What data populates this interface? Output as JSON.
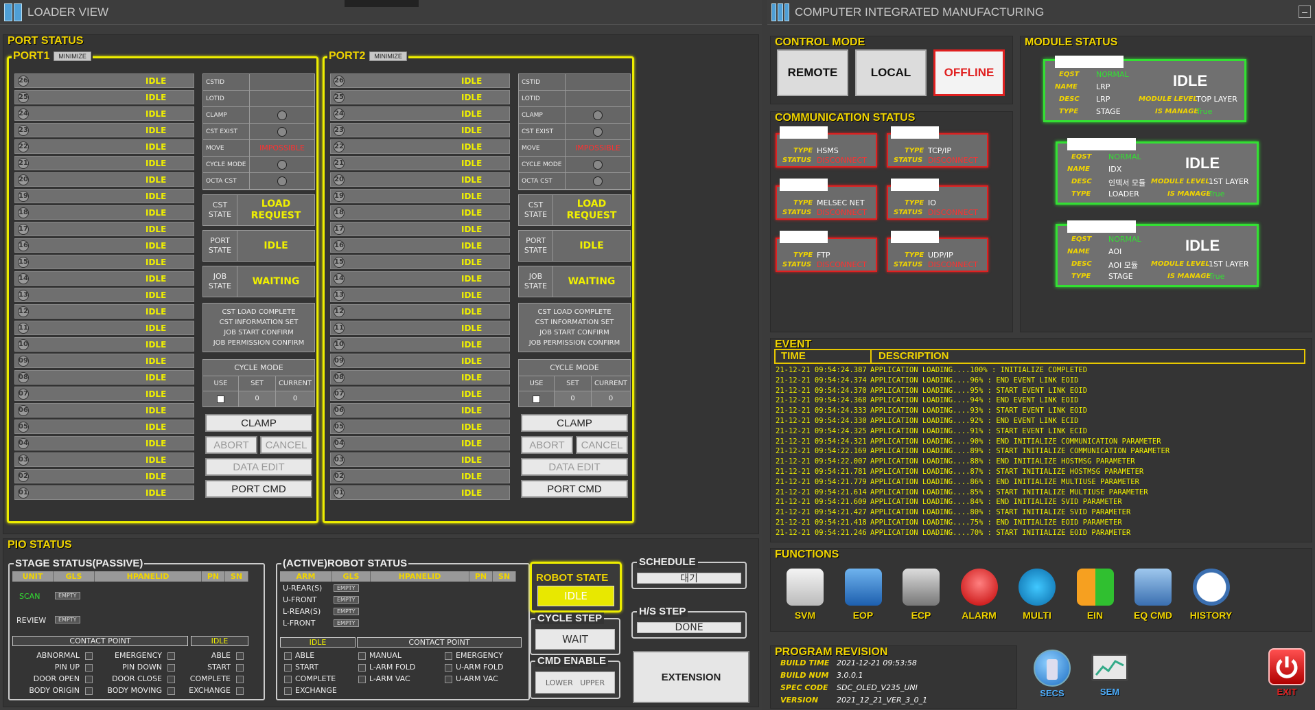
{
  "left_title": "LOADER VIEW",
  "right_title": "COMPUTER INTEGRATED MANUFACTURING",
  "minimize_symbol": "–",
  "port_status_label": "PORT STATUS",
  "ports": [
    {
      "name": "PORT1",
      "minimize": "MINIMIZE",
      "slot_state": "IDLE",
      "info": [
        {
          "k": "CSTID",
          "v": ""
        },
        {
          "k": "LOTID",
          "v": ""
        },
        {
          "k": "CLAMP",
          "v": "radio"
        },
        {
          "k": "CST EXIST",
          "v": "radio"
        },
        {
          "k": "MOVE",
          "v": "IMPOSSIBLE"
        },
        {
          "k": "CYCLE MODE",
          "v": "radio"
        },
        {
          "k": "OCTA CST",
          "v": "radio"
        }
      ],
      "cst_state_k": "CST STATE",
      "cst_state_v": "LOAD REQUEST",
      "port_state_k": "PORT STATE",
      "port_state_v": "IDLE",
      "job_state_k": "JOB STATE",
      "job_state_v": "WAITING",
      "steps": [
        "CST LOAD COMPLETE",
        "CST INFORMATION SET",
        "JOB START CONFIRM",
        "JOB PERMISSION CONFIRM"
      ],
      "cycle_mode": {
        "title": "CYCLE MODE",
        "use": "USE",
        "set": "SET",
        "current": "CURRENT",
        "set_v": "0",
        "current_v": "0"
      },
      "buttons": {
        "clamp": "CLAMP",
        "abort": "ABORT",
        "cancel": "CANCEL",
        "data_edit": "DATA EDIT",
        "port_cmd": "PORT CMD"
      }
    },
    {
      "name": "PORT2",
      "minimize": "MINIMIZE",
      "slot_state": "IDLE",
      "info": [
        {
          "k": "CSTID",
          "v": ""
        },
        {
          "k": "LOTID",
          "v": ""
        },
        {
          "k": "CLAMP",
          "v": "radio"
        },
        {
          "k": "CST EXIST",
          "v": "radio"
        },
        {
          "k": "MOVE",
          "v": "IMPOSSIBLE"
        },
        {
          "k": "CYCLE MODE",
          "v": "radio"
        },
        {
          "k": "OCTA CST",
          "v": "radio"
        }
      ],
      "cst_state_k": "CST STATE",
      "cst_state_v": "LOAD REQUEST",
      "port_state_k": "PORT STATE",
      "port_state_v": "IDLE",
      "job_state_k": "JOB STATE",
      "job_state_v": "WAITING",
      "steps": [
        "CST LOAD COMPLETE",
        "CST INFORMATION SET",
        "JOB START CONFIRM",
        "JOB PERMISSION CONFIRM"
      ],
      "cycle_mode": {
        "title": "CYCLE MODE",
        "use": "USE",
        "set": "SET",
        "current": "CURRENT",
        "set_v": "0",
        "current_v": "0"
      },
      "buttons": {
        "clamp": "CLAMP",
        "abort": "ABORT",
        "cancel": "CANCEL",
        "data_edit": "DATA EDIT",
        "port_cmd": "PORT CMD"
      }
    }
  ],
  "slots": [
    "26",
    "25",
    "24",
    "23",
    "22",
    "21",
    "20",
    "19",
    "18",
    "17",
    "16",
    "15",
    "14",
    "13",
    "12",
    "11",
    "10",
    "09",
    "08",
    "07",
    "06",
    "05",
    "04",
    "03",
    "02",
    "01"
  ],
  "pio_status_label": "PIO STATUS",
  "stage_status": {
    "title": "STAGE STATUS(PASSIVE)",
    "cols": [
      "UNIT",
      "GLS",
      "HPANELID",
      "PN",
      "SN"
    ],
    "rows": [
      {
        "unit": "SCAN",
        "gls": "EMPTY"
      },
      {
        "unit": "REVIEW",
        "gls": "EMPTY"
      }
    ],
    "contact_point": "CONTACT POINT",
    "state": "IDLE",
    "col1": [
      "ABNORMAL",
      "PIN UP",
      "DOOR OPEN",
      "BODY ORIGIN"
    ],
    "col2": [
      "EMERGENCY",
      "PIN DOWN",
      "DOOR CLOSE",
      "BODY MOVING"
    ],
    "col3": [
      "ABLE",
      "START",
      "COMPLETE",
      "EXCHANGE"
    ]
  },
  "robot_status": {
    "title": "(ACTIVE)ROBOT STATUS",
    "cols": [
      "ARM",
      "GLS",
      "HPANELID",
      "PN",
      "SN"
    ],
    "rows": [
      {
        "arm": "U-REAR(S)",
        "gls": "EMPTY"
      },
      {
        "arm": "U-FRONT",
        "gls": "EMPTY"
      },
      {
        "arm": "L-REAR(S)",
        "gls": "EMPTY"
      },
      {
        "arm": "L-FRONT",
        "gls": "EMPTY"
      }
    ],
    "state": "IDLE",
    "contact_point": "CONTACT POINT",
    "col1": [
      "ABLE",
      "START",
      "COMPLETE",
      "EXCHANGE"
    ],
    "col2": [
      "MANUAL",
      "L-ARM FOLD",
      "L-ARM VAC"
    ],
    "col3": [
      "EMERGENCY",
      "U-ARM FOLD",
      "U-ARM VAC"
    ]
  },
  "robot_state": {
    "title": "ROBOT STATE",
    "value": "IDLE"
  },
  "cycle_step": {
    "title": "CYCLE STEP",
    "value": "WAIT"
  },
  "cmd_enable": {
    "title": "CMD ENABLE",
    "value": "LOWER   UPPER"
  },
  "schedule": {
    "title": "SCHEDULE",
    "value": "대기"
  },
  "hs_step": {
    "title": "H/S STEP",
    "value": "DONE"
  },
  "extension": "EXTENSION",
  "control_mode": {
    "label": "CONTROL MODE",
    "remote": "REMOTE",
    "local": "LOCAL",
    "offline": "OFFLINE"
  },
  "communication": {
    "label": "COMMUNICATION STATUS",
    "type_label": "TYPE",
    "status_label": "STATUS",
    "items": [
      {
        "type": "HSMS",
        "status": "DISCONNECT"
      },
      {
        "type": "TCP/IP",
        "status": "DISCONNECT"
      },
      {
        "type": "MELSEC NET",
        "status": "DISCONNECT"
      },
      {
        "type": "IO",
        "status": "DISCONNECT"
      },
      {
        "type": "FTP",
        "status": "DISCONNECT"
      },
      {
        "type": "UDP/IP",
        "status": "DISCONNECT"
      }
    ]
  },
  "module_status": {
    "label": "MODULE STATUS",
    "labels": {
      "eqst": "EQST",
      "name": "NAME",
      "desc": "DESC",
      "type": "TYPE",
      "module_level": "MODULE LEVEL",
      "is_manage": "IS MANAGE"
    },
    "items": [
      {
        "eqst": "NORMAL",
        "name": "LRP",
        "desc": "LRP",
        "type": "STAGE",
        "state": "IDLE",
        "module_level": "TOP LAYER",
        "is_manage": "True"
      },
      {
        "eqst": "NORMAL",
        "name": "IDX",
        "desc": "인덱서 모듈",
        "type": "LOADER",
        "state": "IDLE",
        "module_level": "1ST LAYER",
        "is_manage": "True"
      },
      {
        "eqst": "NORMAL",
        "name": "AOI",
        "desc": "AOI 모듈",
        "type": "STAGE",
        "state": "IDLE",
        "module_level": "1ST LAYER",
        "is_manage": "True"
      }
    ]
  },
  "event": {
    "label": "EVENT",
    "col_time": "TIME",
    "col_desc": "DESCRIPTION",
    "rows": [
      {
        "t": "21-12-21 09:54:24.387",
        "d": "APPLICATION LOADING....100% : INITIALIZE COMPLETED"
      },
      {
        "t": "21-12-21 09:54:24.374",
        "d": "APPLICATION LOADING....96% : END EVENT LINK EOID"
      },
      {
        "t": "21-12-21 09:54:24.370",
        "d": "APPLICATION LOADING....95% : START EVENT LINK EOID"
      },
      {
        "t": "21-12-21 09:54:24.368",
        "d": "APPLICATION LOADING....94% : END EVENT LINK EOID"
      },
      {
        "t": "21-12-21 09:54:24.333",
        "d": "APPLICATION LOADING....93% : START EVENT LINK EOID"
      },
      {
        "t": "21-12-21 09:54:24.330",
        "d": "APPLICATION LOADING....92% : END EVENT LINK ECID"
      },
      {
        "t": "21-12-21 09:54:24.325",
        "d": "APPLICATION LOADING....91% : START EVENT LINK ECID"
      },
      {
        "t": "21-12-21 09:54:24.321",
        "d": "APPLICATION LOADING....90% : END INITIALIZE COMMUNICATION PARAMETER"
      },
      {
        "t": "21-12-21 09:54:22.169",
        "d": "APPLICATION LOADING....89% : START INITIALIZE COMMUNICATION PARAMETER"
      },
      {
        "t": "21-12-21 09:54:22.007",
        "d": "APPLICATION LOADING....88% : END INITIALIZE HOSTMSG PARAMETER"
      },
      {
        "t": "21-12-21 09:54:21.781",
        "d": "APPLICATION LOADING....87% : START INITIALIZE HOSTMSG PARAMETER"
      },
      {
        "t": "21-12-21 09:54:21.779",
        "d": "APPLICATION LOADING....86% : END INITIALIZE MULTIUSE PARAMETER"
      },
      {
        "t": "21-12-21 09:54:21.614",
        "d": "APPLICATION LOADING....85% : START INITIALIZE MULTIUSE PARAMETER"
      },
      {
        "t": "21-12-21 09:54:21.609",
        "d": "APPLICATION LOADING....84% : END INITIALIZE SVID PARAMETER"
      },
      {
        "t": "21-12-21 09:54:21.427",
        "d": "APPLICATION LOADING....80% : START INITIALIZE SVID PARAMETER"
      },
      {
        "t": "21-12-21 09:54:21.418",
        "d": "APPLICATION LOADING....75% : END INITIALIZE EOID PARAMETER"
      },
      {
        "t": "21-12-21 09:54:21.246",
        "d": "APPLICATION LOADING....70% : START INITIALIZE EOID PARAMETER"
      }
    ]
  },
  "functions": {
    "label": "FUNCTIONS",
    "items": [
      {
        "label": "SVM",
        "icon": "monitor-chart-icon"
      },
      {
        "label": "EOP",
        "icon": "screen-icon"
      },
      {
        "label": "ECP",
        "icon": "device-icon"
      },
      {
        "label": "ALARM",
        "icon": "alarm-light-icon"
      },
      {
        "label": "MULTI",
        "icon": "sliders-icon"
      },
      {
        "label": "EIN",
        "icon": "up-down-arrows-icon"
      },
      {
        "label": "EQ CMD",
        "icon": "arrows-icon"
      },
      {
        "label": "HISTORY",
        "icon": "clock-icon"
      }
    ]
  },
  "program_revision": {
    "label": "PROGRAM REVISION",
    "rows": [
      {
        "k": "BUILD TIME",
        "v": "2021-12-21 09:53:58"
      },
      {
        "k": "BUILD NUM",
        "v": "3.0.0.1"
      },
      {
        "k": "SPEC CODE",
        "v": "SDC_OLED_V235_UNI"
      },
      {
        "k": "VERSION",
        "v": "2021_12_21_VER_3_0_1"
      }
    ]
  },
  "bottom_icons": {
    "secs": "SECS",
    "sem": "SEM",
    "exit": "EXIT"
  }
}
